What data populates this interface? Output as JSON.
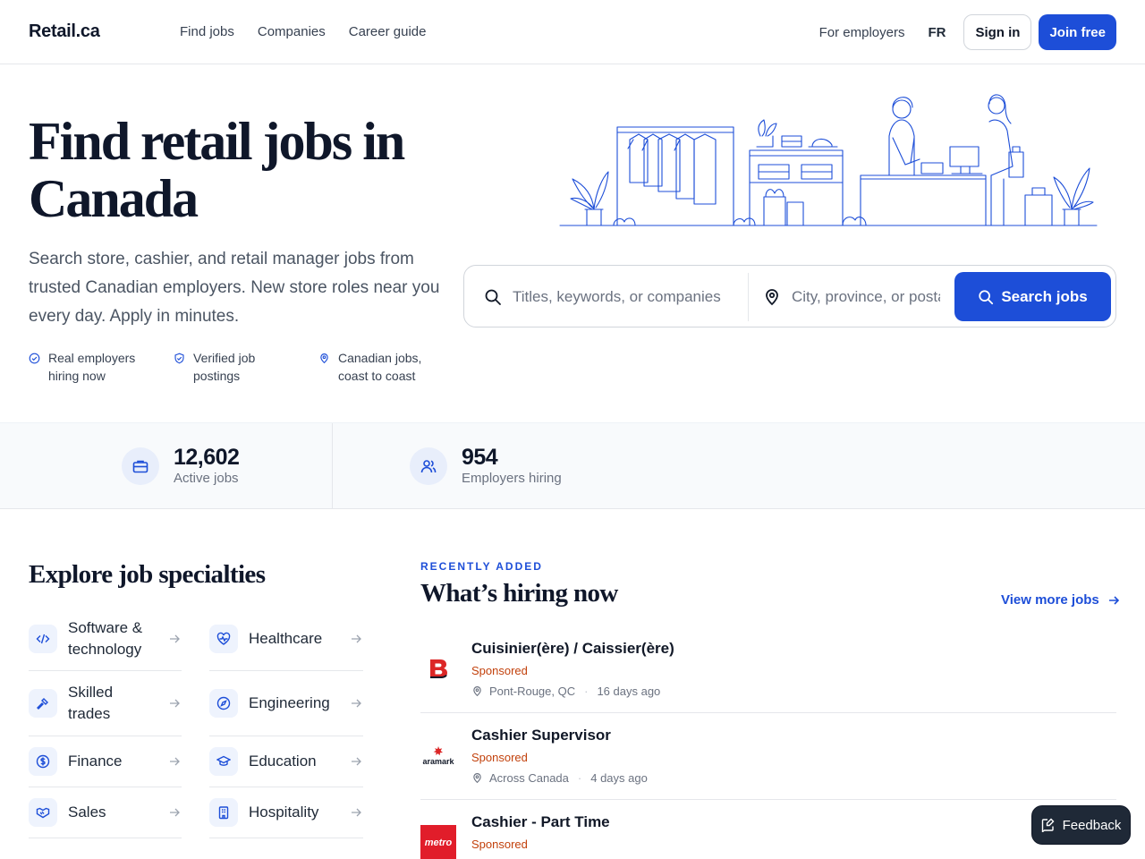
{
  "header": {
    "logo": "Retail.ca",
    "nav": [
      "Find jobs",
      "Companies",
      "Career guide"
    ],
    "for_employers": "For employers",
    "lang": "FR",
    "sign_in": "Sign in",
    "join": "Join free"
  },
  "hero": {
    "title": "Find retail jobs in Canada",
    "subtitle": "Search store, cashier, and retail manager jobs from trusted Canadian employers. New store roles near you every day. Apply in minutes.",
    "trust": [
      {
        "label": "Real employers hiring now",
        "icon": "check-circle-icon"
      },
      {
        "label": "Verified job postings",
        "icon": "shield-check-icon"
      },
      {
        "label": "Canadian jobs, coast to coast",
        "icon": "map-pin-icon"
      }
    ]
  },
  "search": {
    "keyword_placeholder": "Titles, keywords, or companies",
    "location_placeholder": "City, province, or postal code",
    "button": "Search jobs"
  },
  "stats": [
    {
      "value": "12,602",
      "label": "Active jobs",
      "icon": "briefcase-icon"
    },
    {
      "value": "954",
      "label": "Employers hiring",
      "icon": "users-icon"
    }
  ],
  "specialties": {
    "title": "Explore job specialties",
    "items": [
      {
        "label": "Software & technology",
        "icon": "code-icon"
      },
      {
        "label": "Healthcare",
        "icon": "heart-pulse-icon"
      },
      {
        "label": "Skilled trades",
        "icon": "hammer-icon"
      },
      {
        "label": "Engineering",
        "icon": "compass-icon"
      },
      {
        "label": "Finance",
        "icon": "dollar-circle-icon"
      },
      {
        "label": "Education",
        "icon": "graduation-cap-icon"
      },
      {
        "label": "Sales",
        "icon": "handshake-icon"
      },
      {
        "label": "Hospitality",
        "icon": "building-icon"
      }
    ]
  },
  "recent": {
    "eyebrow": "RECENTLY ADDED",
    "title": "What’s hiring now",
    "view_more": "View more jobs",
    "jobs": [
      {
        "title": "Cuisinier(ère) / Caissier(ère)",
        "sponsored": "Sponsored",
        "location": "Pont-Rouge, QC",
        "age": "16 days ago",
        "logo_text": "B",
        "logo_color": "#dc2626"
      },
      {
        "title": "Cashier Supervisor",
        "sponsored": "Sponsored",
        "location": "Across Canada",
        "age": "4 days ago",
        "logo_text": "aramark",
        "logo_color": "#dc2626"
      },
      {
        "title": "Cashier - Part Time",
        "sponsored": "Sponsored",
        "location": "",
        "age": "",
        "logo_text": "metro",
        "logo_color": "#e11d2a"
      }
    ]
  },
  "feedback": "Feedback",
  "colors": {
    "accent": "#1d4ed8",
    "sponsored": "#c2410c",
    "dark": "#0f172a"
  }
}
